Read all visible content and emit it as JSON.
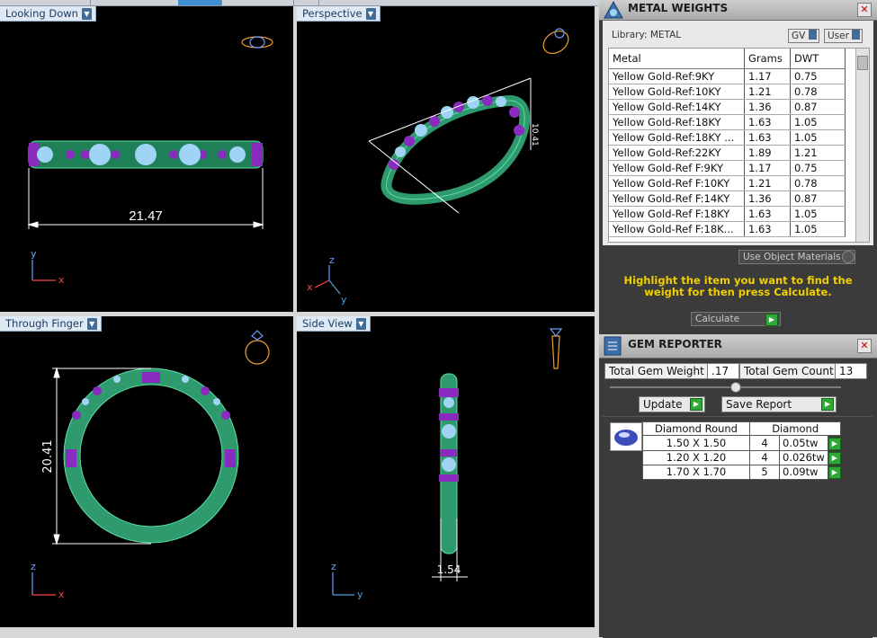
{
  "viewports": {
    "top_left": {
      "label": "Looking Down",
      "dimension": "21.47",
      "axis_a": "y",
      "axis_b": "x"
    },
    "top_right": {
      "label": "Perspective",
      "dimension": "10.41",
      "axis_a": "z",
      "axis_b": "x",
      "axis_c": "y"
    },
    "bottom_left": {
      "label": "Through Finger",
      "dimension": "20.41",
      "axis_a": "z",
      "axis_b": "x"
    },
    "bottom_right": {
      "label": "Side View",
      "dimension": "1.54",
      "axis_a": "z",
      "axis_b": "y"
    }
  },
  "metal_weights": {
    "title": "METAL WEIGHTS",
    "library_label": "Library: METAL",
    "gv_label": "GV",
    "user_label": "User",
    "columns": [
      "Metal",
      "Grams",
      "DWT"
    ],
    "rows": [
      [
        "Yellow Gold-Ref:9KY",
        "1.17",
        "0.75"
      ],
      [
        "Yellow Gold-Ref:10KY",
        "1.21",
        "0.78"
      ],
      [
        "Yellow Gold-Ref:14KY",
        "1.36",
        "0.87"
      ],
      [
        "Yellow Gold-Ref:18KY",
        "1.63",
        "1.05"
      ],
      [
        "Yellow Gold-Ref:18KY ...",
        "1.63",
        "1.05"
      ],
      [
        "Yellow Gold-Ref:22KY",
        "1.89",
        "1.21"
      ],
      [
        "Yellow Gold-Ref F:9KY",
        "1.17",
        "0.75"
      ],
      [
        "Yellow Gold-Ref F:10KY",
        "1.21",
        "0.78"
      ],
      [
        "Yellow Gold-Ref F:14KY",
        "1.36",
        "0.87"
      ],
      [
        "Yellow Gold-Ref F:18KY",
        "1.63",
        "1.05"
      ],
      [
        "Yellow Gold-Ref F:18K...",
        "1.63",
        "1.05"
      ]
    ],
    "use_object_materials": "Use Object Materials",
    "hint": "Highlight the item you want to find the weight for then press Calculate.",
    "calculate_label": "Calculate"
  },
  "gem_reporter": {
    "title": "GEM REPORTER",
    "total_gem_weight_label": "Total Gem Weight",
    "total_gem_weight": ".17",
    "total_gem_count_label": "Total Gem Count",
    "total_gem_count": "13",
    "update_label": "Update",
    "save_report_label": "Save Report",
    "gem_type": "Diamond Round",
    "gem_material": "Diamond",
    "rows": [
      [
        "1.50 X 1.50",
        "4",
        "0.05tw"
      ],
      [
        "1.20 X 1.20",
        "4",
        "0.026tw"
      ],
      [
        "1.70 X 1.70",
        "5",
        "0.09tw"
      ]
    ]
  },
  "colors": {
    "accent_label": "#dfe9f3",
    "hint": "#f0d000",
    "ring_green": "#2e9a6e",
    "gem_purple": "#8a2bbf",
    "gem_blue": "#9fd4f5"
  }
}
